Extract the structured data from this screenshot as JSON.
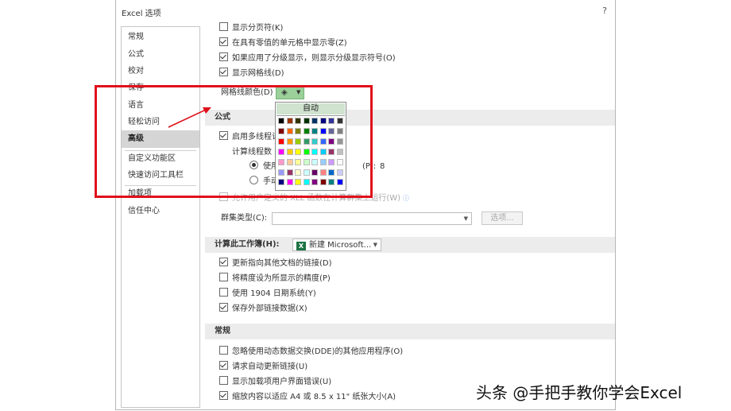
{
  "window": {
    "title": "Excel 选项",
    "help": "?"
  },
  "nav": {
    "items": [
      "常规",
      "公式",
      "校对",
      "保存",
      "语言",
      "轻松访问",
      "高级",
      "自定义功能区",
      "快速访问工具栏",
      "加载项",
      "信任中心"
    ],
    "active": "高级"
  },
  "display": {
    "page_breaks": "显示分页符(K)",
    "zero_values": "在具有零值的单元格中显示零(Z)",
    "outline": "如果应用了分级显示，则显示分级显示符号(O)",
    "gridlines": "显示网格线(D)",
    "gridline_color_label": "网格线颜色(D)"
  },
  "palette": {
    "auto_label": "自动",
    "rows": [
      [
        "#000000",
        "#993300",
        "#333300",
        "#003300",
        "#003366",
        "#000080",
        "#333399",
        "#333333"
      ],
      [
        "#800000",
        "#FF6600",
        "#808000",
        "#008000",
        "#008080",
        "#0000FF",
        "#666699",
        "#808080"
      ],
      [
        "#FF0000",
        "#FF9900",
        "#99CC00",
        "#339966",
        "#33CCCC",
        "#3366FF",
        "#800080",
        "#969696"
      ],
      [
        "#FF00FF",
        "#FFCC00",
        "#FFFF00",
        "#00FF00",
        "#00FFFF",
        "#00CCFF",
        "#993366",
        "#C0C0C0"
      ],
      [
        "#FF99CC",
        "#FFCC99",
        "#FFFF99",
        "#CCFFCC",
        "#CCFFFF",
        "#99CCFF",
        "#CC99FF",
        "#FFFFFF"
      ],
      [
        "#9999FF",
        "#993366",
        "#FFFFCC",
        "#CCFFFF",
        "#660066",
        "#FF8080",
        "#0066CC",
        "#CCCCFF"
      ],
      [
        "#000080",
        "#FF00FF",
        "#FFFF00",
        "#00FFFF",
        "#800080",
        "#800000",
        "#008080",
        "#0000FF"
      ]
    ]
  },
  "formulas": {
    "section": "公式",
    "multithread": "启用多线程计",
    "thread_count_label": "计算线程数",
    "use_all": "使用",
    "processors_suffix": "(P):",
    "processors_value": "8",
    "manual": "手动",
    "user_defined": "允许用户定义的 XLL 函数在计算群集上运行(W)",
    "cluster_type_label": "群集类型(C):",
    "options_button": "选项..."
  },
  "calc_workbook": {
    "section": "计算此工作簿(H):",
    "workbook_name": "新建 Microsoft...",
    "update_links": "更新指向其他文档的链接(D)",
    "precision": "将精度设为所显示的精度(P)",
    "date1904": "使用 1904 日期系统(Y)",
    "save_links": "保存外部链接数据(X)"
  },
  "general": {
    "section": "常规",
    "ignore_dde": "忽略使用动态数据交换(DDE)的其他应用程序(O)",
    "auto_update": "请求自动更新链接(U)",
    "addin_errors": "显示加载项用户界面错误(U)",
    "scale_content": "缩放内容以适应 A4 或 8.5 x 11\" 纸张大小(A)"
  },
  "watermark": "头条 @手把手教你学会Excel",
  "colors": {
    "highlight": "#e0101b",
    "color_button": "#9bd09b",
    "excel_green": "#1d7344"
  }
}
